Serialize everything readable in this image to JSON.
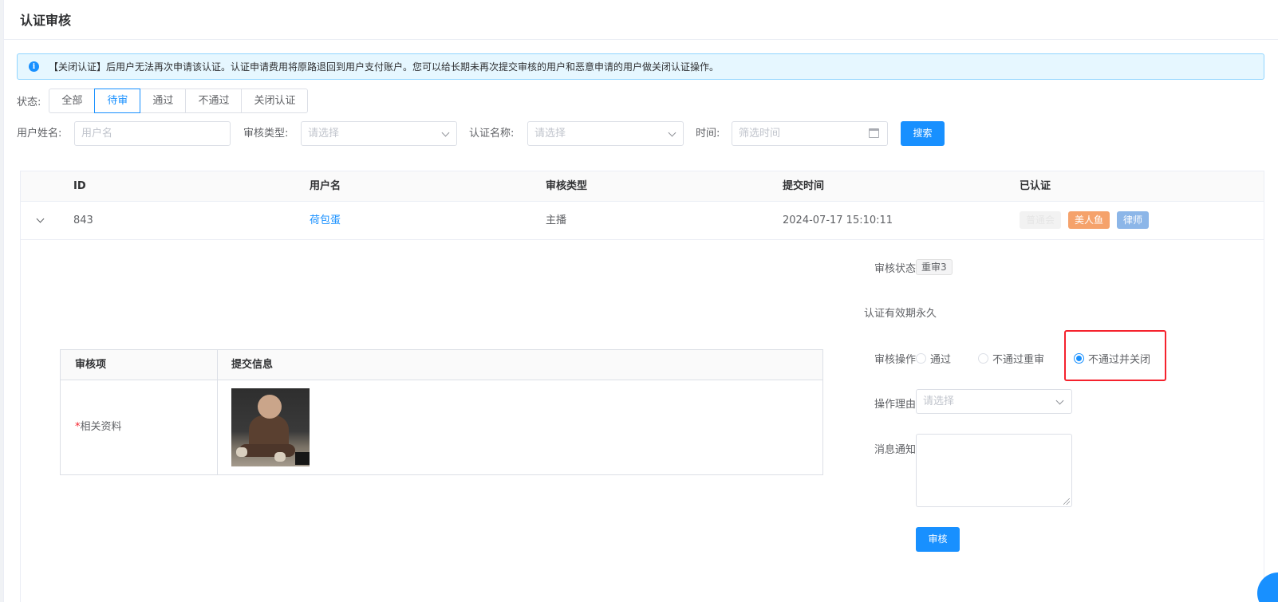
{
  "page": {
    "title": "认证审核"
  },
  "alert": {
    "text": "【关闭认证】后用户无法再次申请该认证。认证申请费用将原路退回到用户支付账户。您可以给长期未再次提交审核的用户和恶意申请的用户做关闭认证操作。",
    "icon": "info-icon"
  },
  "status_filter": {
    "label": "状态:",
    "options": [
      "全部",
      "待审",
      "通过",
      "不通过",
      "关闭认证"
    ],
    "selected": "待审"
  },
  "filters": {
    "username_label": "用户姓名:",
    "username_placeholder": "用户名",
    "type_label": "审核类型:",
    "type_placeholder": "请选择",
    "cert_label": "认证名称:",
    "cert_placeholder": "请选择",
    "time_label": "时间:",
    "time_placeholder": "筛选时间",
    "search_button": "搜索"
  },
  "table": {
    "columns": [
      "ID",
      "用户名",
      "审核类型",
      "提交时间",
      "已认证"
    ],
    "rows": [
      {
        "id": "843",
        "username": "荷包蛋",
        "type": "主播",
        "submitted": "2024-07-17 15:10:11",
        "tags": [
          {
            "label": "普通会",
            "color": "#f2f2f2"
          },
          {
            "label": "美人鱼",
            "color": "#f5a26b"
          },
          {
            "label": "律师",
            "color": "#8cb6e8"
          }
        ]
      }
    ]
  },
  "detail": {
    "items_table": {
      "columns": [
        "审核项",
        "提交信息"
      ],
      "rows": [
        {
          "required_mark": "*",
          "label": "相关资料"
        }
      ]
    },
    "form": {
      "status_label": "审核状态",
      "status_value": "重审3",
      "validity_label": "认证有效期",
      "validity_value": "永久",
      "action_label": "审核操作",
      "action_options": [
        "通过",
        "不通过重审",
        "不通过并关闭"
      ],
      "action_selected": "不通过并关闭",
      "reason_label": "操作理由",
      "reason_placeholder": "请选择",
      "notify_label": "消息通知",
      "submit_button": "审核"
    }
  }
}
